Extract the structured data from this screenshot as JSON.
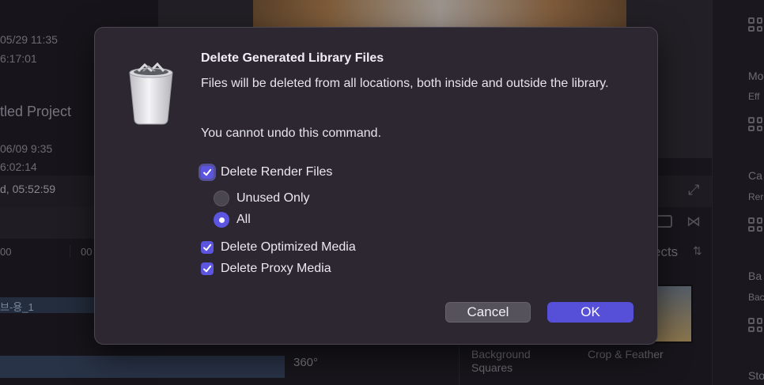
{
  "background": {
    "left_texts": [
      "05/29 11:35",
      "6:17:01",
      "tled Project",
      "06/09 9:35",
      "6:02:14",
      "d, 05:52:59",
      "00",
      "00",
      "브-용_1"
    ],
    "effects_label": "ects",
    "effect_items": [
      "Background\nSquares",
      "Crop & Feather"
    ],
    "degree_label": "360°",
    "right_labels": [
      "Mo",
      "Eff",
      "Ca",
      "Rer",
      "Ba",
      "Bac",
      "Sto"
    ]
  },
  "dialog": {
    "title": "Delete Generated Library Files",
    "message": "Files will be deleted from all locations, both inside and outside the library.",
    "warning": "You cannot undo this command.",
    "options": {
      "render_files": {
        "label": "Delete Render Files",
        "checked": true
      },
      "unused_only": {
        "label": "Unused Only",
        "selected": false
      },
      "all": {
        "label": "All",
        "selected": true
      },
      "optimized_media": {
        "label": "Delete Optimized Media",
        "checked": true
      },
      "proxy_media": {
        "label": "Delete Proxy Media",
        "checked": true
      }
    },
    "buttons": {
      "cancel": "Cancel",
      "ok": "OK"
    },
    "icon": "trash-can-icon",
    "accent_color": "#5b55e0"
  }
}
